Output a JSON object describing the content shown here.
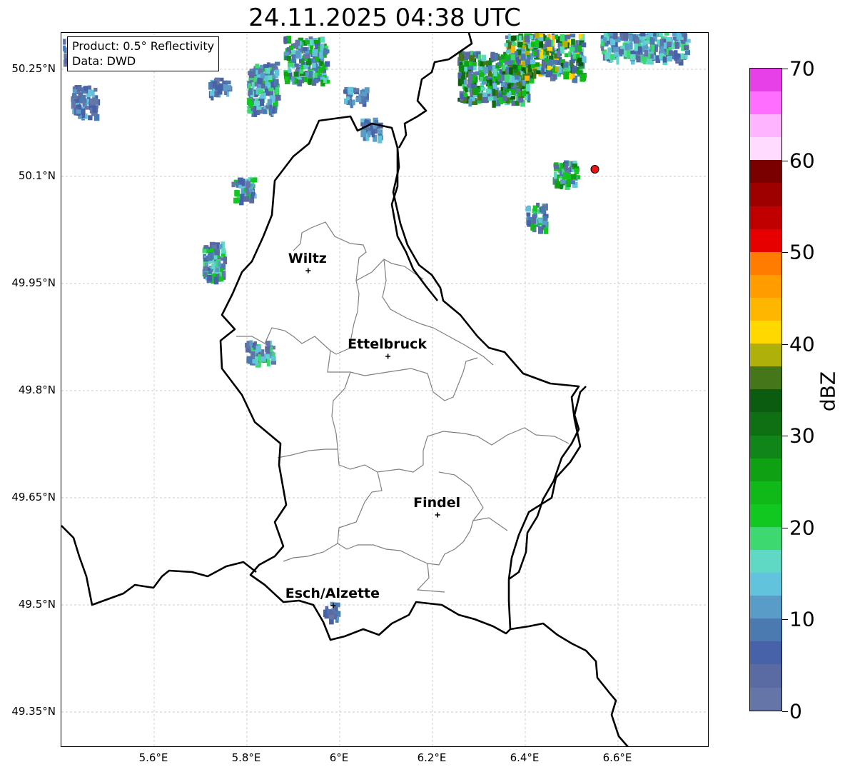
{
  "title": "24.11.2025 04:38 UTC",
  "info": {
    "product": "Product: 0.5° Reflectivity",
    "source": "Data: DWD"
  },
  "axes": {
    "lat_ticks": [
      "50.25°N",
      "50.1°N",
      "49.95°N",
      "49.8°N",
      "49.65°N",
      "49.5°N",
      "49.35°N"
    ],
    "lon_ticks": [
      "5.6°E",
      "5.8°E",
      "6°E",
      "6.2°E",
      "6.4°E",
      "6.6°E"
    ]
  },
  "cities": [
    {
      "name": "Wiltz",
      "lat": 49.968,
      "lon": 5.932
    },
    {
      "name": "Ettelbruck",
      "lat": 49.848,
      "lon": 6.104
    },
    {
      "name": "Findel",
      "lat": 49.626,
      "lon": 6.211
    },
    {
      "name": "Esch/Alzette",
      "lat": 49.499,
      "lon": 5.986
    }
  ],
  "marker": {
    "lat": 50.11,
    "lon": 6.55,
    "color": "#ee1111"
  },
  "colorbar": {
    "unit": "dBZ",
    "tick_labels": [
      "0",
      "10",
      "20",
      "30",
      "40",
      "50",
      "60",
      "70"
    ],
    "min": 0,
    "max": 70,
    "colors": [
      "#6675a8",
      "#5a6aa2",
      "#4762a8",
      "#4b7ab0",
      "#5a9cc8",
      "#62c4dc",
      "#5fd8c4",
      "#3ed870",
      "#10c820",
      "#10b818",
      "#10a014",
      "#10861a",
      "#0e7012",
      "#0b5c10",
      "#45761a",
      "#b0b00a",
      "#ffd800",
      "#ffb600",
      "#ff9c00",
      "#ff7c00",
      "#e60000",
      "#c00000",
      "#9e0000",
      "#7a0000",
      "#ffdcff",
      "#ffb4ff",
      "#ff6eff",
      "#e840e8"
    ]
  },
  "colors": {
    "border": "#000000",
    "districts": "#808080",
    "grid": "#bbbbbb"
  }
}
